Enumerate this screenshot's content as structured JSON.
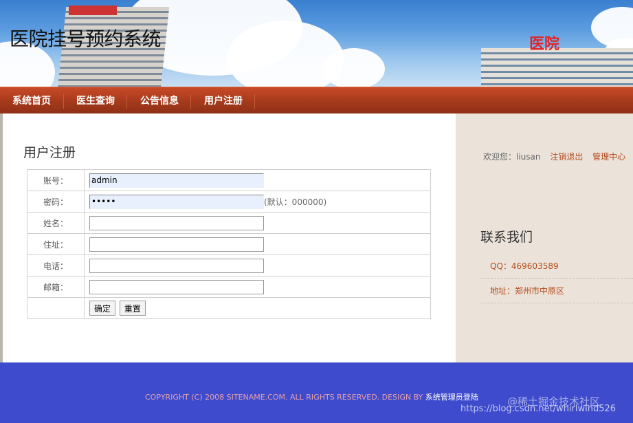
{
  "header": {
    "site_title": "医院挂号预约系统",
    "banner_sign": "医院"
  },
  "nav": {
    "items": [
      {
        "label": "系统首页"
      },
      {
        "label": "医生查询"
      },
      {
        "label": "公告信息"
      },
      {
        "label": "用户注册"
      }
    ]
  },
  "main": {
    "page_title": "用户注册",
    "form": {
      "account": {
        "label": "账号：",
        "value": "admin"
      },
      "password": {
        "label": "密码：",
        "value": "00000",
        "hint": "(默认：000000)"
      },
      "name": {
        "label": "姓名：",
        "value": ""
      },
      "address": {
        "label": "住址：",
        "value": ""
      },
      "phone": {
        "label": "电话：",
        "value": ""
      },
      "email": {
        "label": "邮箱：",
        "value": ""
      },
      "submit_label": "确定",
      "reset_label": "重置"
    }
  },
  "sidebar": {
    "welcome_prefix": "欢迎您：",
    "username": "liusan",
    "logout_label": "注销退出",
    "admin_label": "管理中心",
    "contact_title": "联系我们",
    "qq": "QQ：469603589",
    "address": "地址：郑州市中原区"
  },
  "footer": {
    "copyright": "COPYRIGHT (C) 2008 SITENAME.COM. ALL RIGHTS RESERVED. DESIGN BY ",
    "admin_login_label": "系统管理员登陆",
    "watermark_site": "@稀土掘金技术社区",
    "watermark_url": "https://blog.csdn.net/whirlwind526"
  },
  "colors": {
    "nav_bg": "#a53a1c",
    "footer_bg": "#3e4bcc",
    "link_accent": "#b54a1b",
    "sidebar_bg": "#ebe3da"
  }
}
